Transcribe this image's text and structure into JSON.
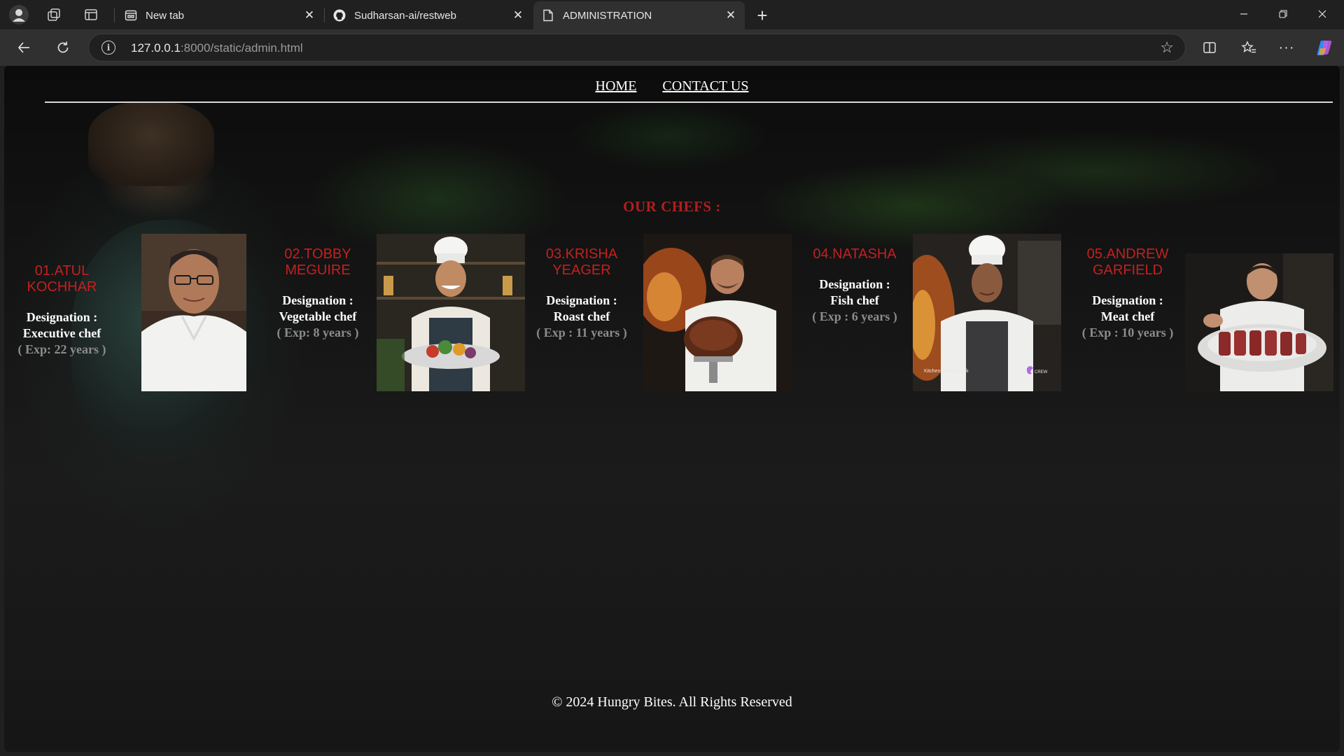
{
  "browser": {
    "tabs": [
      {
        "title": "New tab",
        "icon": "newtab-page-icon"
      },
      {
        "title": "Sudharsan-ai/restweb",
        "icon": "github-icon"
      },
      {
        "title": "ADMINISTRATION",
        "icon": "document-icon"
      }
    ],
    "url_host": "127.0.0.1",
    "url_rest": ":8000/static/admin.html"
  },
  "nav": {
    "home": "HOME",
    "contact": "CONTACT US"
  },
  "heading": "OUR CHEFS :",
  "chefs": [
    {
      "name": "01.ATUL KOCHHAR",
      "designation_label": "Designation :",
      "designation": "Executive chef",
      "experience": "( Exp: 22 years )"
    },
    {
      "name": "02.TOBBY MEGUIRE",
      "designation_label": "Designation :",
      "designation": "Vegetable chef",
      "experience": "( Exp: 8 years )"
    },
    {
      "name": "03.KRISHA YEAGER",
      "designation_label": "Designation :",
      "designation": "Roast chef",
      "experience": "( Exp : 11 years )"
    },
    {
      "name": "04.NATASHA",
      "designation_label": "Designation :",
      "designation": "Fish chef",
      "experience": "( Exp : 6 years )"
    },
    {
      "name": "05.ANDREW GARFIELD",
      "designation_label": "Designation :",
      "designation": "Meat chef",
      "experience": "( Exp : 10 years )"
    }
  ],
  "photo_captions": {
    "chef4_left": "Kitchen Crew | Cook",
    "chef4_right": "CREW"
  },
  "footer": "© 2024 Hungry Bites. All Rights Reserved",
  "colors": {
    "accent_red": "#c42020",
    "background": "#141414"
  }
}
